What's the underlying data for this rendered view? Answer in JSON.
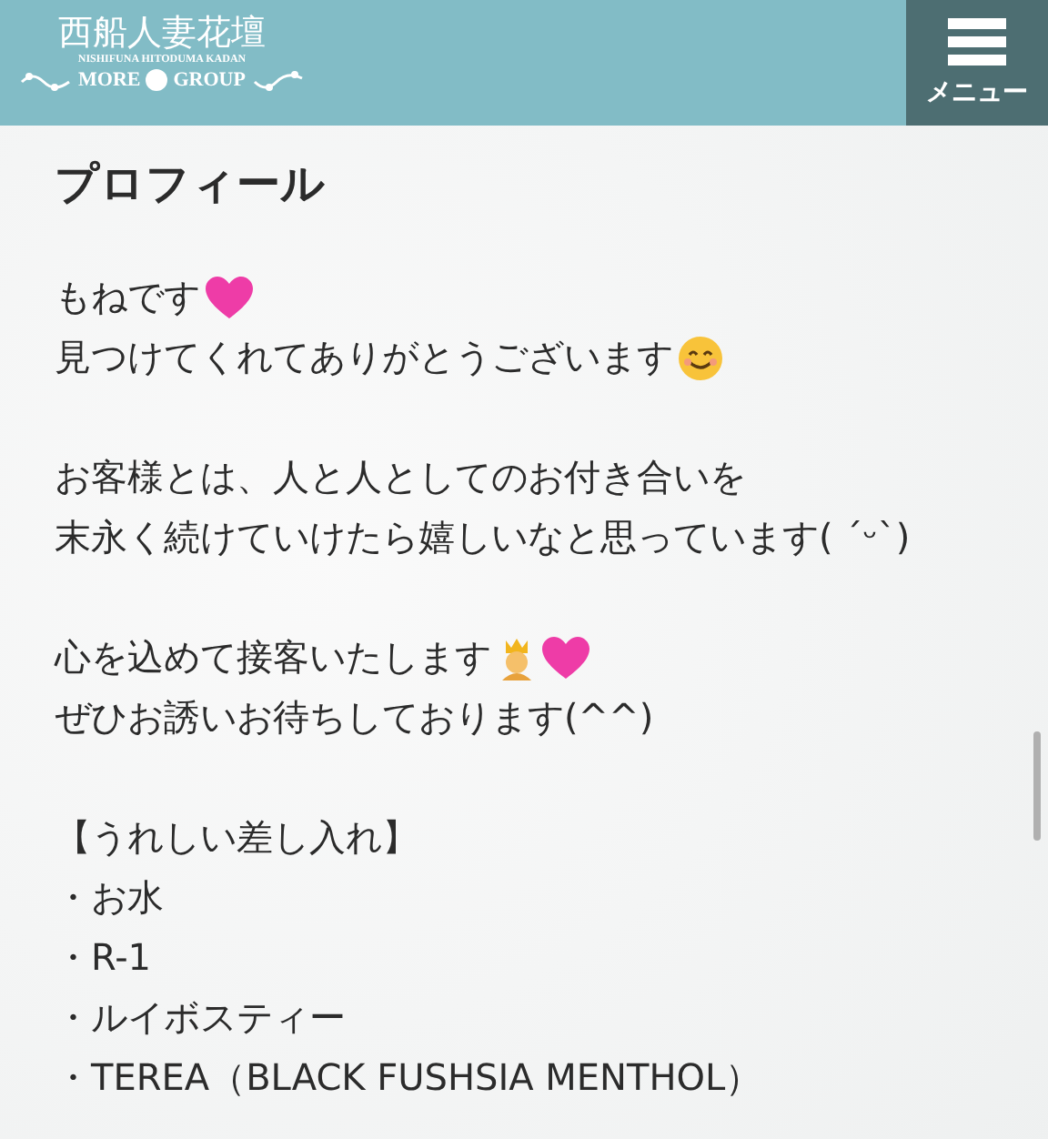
{
  "header": {
    "logo_title": "西船人妻花壇",
    "logo_subtitle": "NISHIFUNA HITODUMA KADAN",
    "logo_left": "MORE",
    "logo_right": "GROUP",
    "menu_label": "メニュー"
  },
  "profile": {
    "title": "プロフィール",
    "paragraphs": [
      [
        {
          "text": "もねです",
          "kind": "heart"
        },
        {
          "text": "見つけてくれてありがとうございます",
          "kind": "smile"
        }
      ],
      [
        {
          "text": "お客様とは、人と人としてのお付き合いを",
          "kind": "plain"
        },
        {
          "text": "末永く続けていけたら嬉しいなと思っています( ˊᵕˋ)",
          "kind": "plain"
        }
      ],
      [
        {
          "text": "心を込めて接客いたします",
          "kind": "crown-heart"
        },
        {
          "text": "ぜひお誘いお待ちしております(^^)",
          "kind": "plain"
        }
      ],
      [
        {
          "text": "【うれしい差し入れ】",
          "kind": "plain"
        },
        {
          "text": "・お水",
          "kind": "plain"
        },
        {
          "text": "・R-1",
          "kind": "plain"
        },
        {
          "text": "・ルイボスティー",
          "kind": "plain"
        },
        {
          "text": "・TEREA（BLACK FUSHSIA MENTHOL）",
          "kind": "plain"
        }
      ]
    ]
  }
}
